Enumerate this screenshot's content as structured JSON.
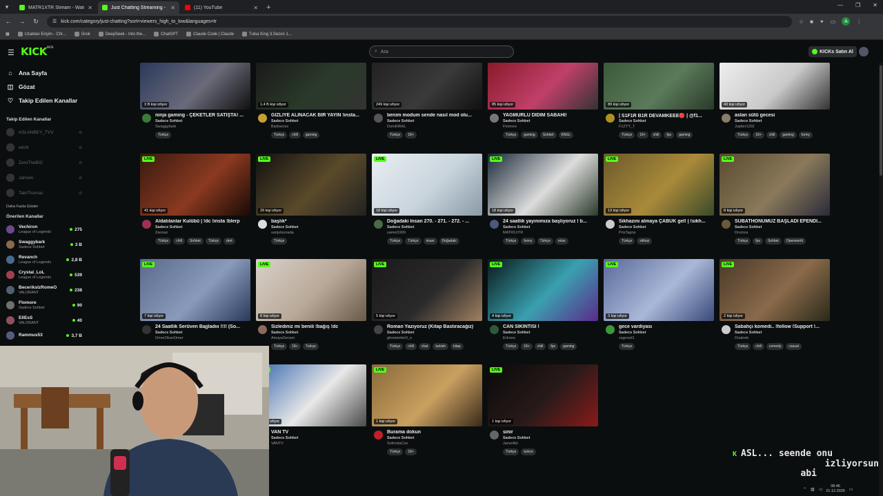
{
  "browser": {
    "tabs": [
      {
        "title": "MATR1XTR Stream - Watch Live",
        "color": "#53fc18",
        "active": false
      },
      {
        "title": "Just Chatting Streaming - Live",
        "color": "#53fc18",
        "active": true
      },
      {
        "title": "(11) YouTube",
        "color": "#ff0000",
        "active": false
      }
    ],
    "url": "kick.com/category/just-chatting?sort=viewers_high_to_low&languages=tr",
    "bookmarks": [
      "Uzaktan Erişim - Chr...",
      "Grok",
      "DeepSeek - Into the...",
      "ChatGPT",
      "Claude Code | Claude",
      "Tulsa King 3.Sezon 1..."
    ]
  },
  "header": {
    "logo": "KICK",
    "logo_sup": "BETA",
    "search_placeholder": "Ara",
    "kicks_button": "KICKs Satın Al"
  },
  "sidebar": {
    "nav": [
      {
        "label": "Ana Sayfa",
        "icon": "home-icon",
        "glyph": "⌂"
      },
      {
        "label": "Gözat",
        "icon": "compass-icon",
        "glyph": "◫"
      },
      {
        "label": "Takip Edilen Kanallar",
        "icon": "heart-icon",
        "glyph": "♡"
      }
    ],
    "followed_title": "Takip Edilen Kanallar",
    "followed": [
      {
        "name": "ASLANBEY_TVV"
      },
      {
        "name": "wtcN"
      },
      {
        "name": "ZeroTheBIC"
      },
      {
        "name": "Jahrein"
      },
      {
        "name": "TaleThomas"
      }
    ],
    "more_label": "Daha Fazla Göster",
    "recommended_title": "Önerilen Kanallar",
    "recommended": [
      {
        "name": "Vechiron",
        "category": "League of Legends",
        "viewers": "275",
        "color": "#6b4a8a"
      },
      {
        "name": "Swaggybark",
        "category": "Sadece Sohbet",
        "viewers": "3 B",
        "color": "#8a6a4a"
      },
      {
        "name": "Revanch",
        "category": "League of Legends",
        "viewers": "2,8 B",
        "color": "#4a6a8a"
      },
      {
        "name": "Crystal_LoL",
        "category": "League of Legends",
        "viewers": "539",
        "color": "#a04050"
      },
      {
        "name": "BecerikslzRomeO",
        "category": "VALORANT",
        "viewers": "238",
        "color": "#506070"
      },
      {
        "name": "Flomore",
        "category": "Sadece Sohbet",
        "viewers": "90",
        "color": "#707070"
      },
      {
        "name": "EllEsS",
        "category": "VALORANT",
        "viewers": "40",
        "color": "#905060"
      },
      {
        "name": "Rammus53",
        "category": "",
        "viewers": "3,7 B",
        "color": "#5a5a80"
      }
    ]
  },
  "cards": [
    {
      "row": 0,
      "col": 0,
      "live": false,
      "views": "3 B kişi izliyor",
      "title": "ninja gaming - ÇEKETLER SATIŞTA! ...",
      "category": "Sadece Sohbet",
      "channel": "Swaggybark",
      "tags": [
        "Türkçe"
      ],
      "avatar": "#3a7a3a",
      "thumb": [
        "#2a3a5a",
        "#6a6a7a",
        "#111"
      ]
    },
    {
      "row": 0,
      "col": 1,
      "live": false,
      "views": "1,4 B kişi izliyor",
      "title": "GİZLİYE ALINACAK BİR YAYIN !insta...",
      "category": "Sadece Sohbet",
      "channel": "Barbaross",
      "tags": [
        "Türkçe",
        "chill",
        "gaming"
      ],
      "avatar": "#c8a030",
      "thumb": [
        "#1a1a1a",
        "#2a3a2a",
        "#333"
      ]
    },
    {
      "row": 0,
      "col": 2,
      "live": false,
      "views": "249 kişi izliyor",
      "title": "benim modum sende nasıl mod olu...",
      "category": "Sadece Sohbet",
      "channel": "DomKIRAL",
      "tags": [
        "Türkçe",
        "18+"
      ],
      "avatar": "#555",
      "thumb": [
        "#222",
        "#3a3a3a",
        "#111"
      ]
    },
    {
      "row": 0,
      "col": 3,
      "live": false,
      "views": "85 kişi izliyor",
      "title": "YAĞMURLU DİDİM SABAHI!",
      "category": "Sadece Sohbet",
      "channel": "Flomore",
      "tags": [
        "Türkçe",
        "gaming",
        "Sohbet",
        "KNGL"
      ],
      "avatar": "#777",
      "thumb": [
        "#8a1a2a",
        "#c0406a",
        "#333"
      ]
    },
    {
      "row": 0,
      "col": 4,
      "live": false,
      "views": "89 kişi izliyor",
      "title": "| S1F1R B1R DEVAMKEEE🔴 | @f1...",
      "category": "Sadece Sohbet",
      "channel": "F1ZYY_T",
      "tags": [
        "Türkçe",
        "18+",
        "chill",
        "fps",
        "gaming"
      ],
      "avatar": "#b09020",
      "thumb": [
        "#3a5a3a",
        "#5a7a5a",
        "#2a3a2a"
      ]
    },
    {
      "row": 0,
      "col": 5,
      "live": false,
      "views": "43 kişi izliyor",
      "title": "aslan sütü gecesi",
      "category": "Sadece Sohbet",
      "channel": "Jupiter1202",
      "tags": [
        "Türkçe",
        "18+",
        "chill",
        "gaming",
        "funny"
      ],
      "avatar": "#8a7a6a",
      "thumb": [
        "#eee",
        "#c9c9c9",
        "#333"
      ]
    },
    {
      "row": 1,
      "col": 0,
      "live": true,
      "views": "41 kişi izliyor",
      "title": "Aldatılanlar Kulübü | !dc !insta !blerp",
      "category": "Sadece Sohbet",
      "channel": "Zaonaz",
      "tags": [
        "Türkçe",
        "chill",
        "Sohbet",
        "Türkçe",
        "dert"
      ],
      "avatar": "#a03050",
      "thumb": [
        "#3a1a10",
        "#8a3a20",
        "#1a0a05"
      ]
    },
    {
      "row": 1,
      "col": 1,
      "live": true,
      "views": "29 kişi izliyor",
      "title": "başlık*",
      "category": "Sadece Sohbet",
      "channel": "sanjutsunada",
      "tags": [
        "Türkçe"
      ],
      "avatar": "#ddd",
      "thumb": [
        "#111",
        "#5a4a2a",
        "#222"
      ]
    },
    {
      "row": 1,
      "col": 2,
      "live": true,
      "views": "18 kişi izliyor",
      "title": "Doğadaki İnsan 270. - 271. - 272. - ...",
      "category": "Sadece Sohbet",
      "channel": "samet1909",
      "tags": [
        "Türkçe",
        "Türkçe",
        "insan",
        "Doğadaki"
      ],
      "avatar": "#4a6a4a",
      "thumb": [
        "#e8eef2",
        "#c9d4dc",
        "#8a9aa8"
      ]
    },
    {
      "row": 1,
      "col": 3,
      "live": true,
      "views": "18 kişi izliyor",
      "title": "24 saatlik yayınımıza başlıyoruz ! b...",
      "category": "Sadece Sohbet",
      "channel": "MATR1XTR",
      "tags": [
        "Türkçe",
        "funny",
        "Türkçe",
        "relax"
      ],
      "avatar": "#4a5a7a",
      "thumb": [
        "#1a2a3a",
        "#dcdcdc",
        "#2a3a2a"
      ]
    },
    {
      "row": 1,
      "col": 4,
      "live": true,
      "views": "13 kişi izliyor",
      "title": "Sikhazını almaya ÇABUK gel! | !sikh...",
      "category": "Sadece Sohbet",
      "channel": "PrisTagna",
      "tags": [
        "Türkçe",
        "sikhaz"
      ],
      "avatar": "#ccc",
      "thumb": [
        "#6a5a2a",
        "#aa8a3a",
        "#3a4a2a"
      ]
    },
    {
      "row": 1,
      "col": 5,
      "live": true,
      "views": "8 kişi izliyor",
      "title": "SUBATHONUMUZ BAŞLADI EFENDİ...",
      "category": "Sadece Sohbet",
      "channel": "Drumza",
      "tags": [
        "Türkçe",
        "fps",
        "Sohbet",
        "Openworld"
      ],
      "avatar": "#6a5a3a",
      "thumb": [
        "#5a4a30",
        "#8a7a5a",
        "#2a2a3a"
      ]
    },
    {
      "row": 2,
      "col": 0,
      "live": true,
      "views": "7 kişi izliyor",
      "title": "24 Saatlik Serüven Bajjladııı !!!! (So...",
      "category": "Sadece Sohbet",
      "channel": "OmerOkanOmer",
      "tags": [],
      "avatar": "#333",
      "thumb": [
        "#5a6a8a",
        "#8a9aba",
        "#2a3a5a"
      ]
    },
    {
      "row": 2,
      "col": 1,
      "live": true,
      "views": "8 kişi izliyor",
      "title": "Sizlediniz mi benili !bağış !dc",
      "category": "Sadece Sohbet",
      "channel": "AmayaSensei",
      "tags": [
        "Türkçe",
        "18+",
        "Türkçe"
      ],
      "avatar": "#8a6a5a",
      "thumb": [
        "#d8d0c8",
        "#b8a898",
        "#6a5a4a"
      ]
    },
    {
      "row": 2,
      "col": 2,
      "live": true,
      "views": "5 kişi izliyor",
      "title": "Roman Yazıyoruz (Kitap Bastıracağız)",
      "category": "Sadece Sohbet",
      "channel": "ghostwriter0_o",
      "tags": [
        "Türkçe",
        "chill",
        "chat",
        "turkish",
        "kitap"
      ],
      "avatar": "#444",
      "thumb": [
        "#1a1a1a",
        "#2a2a2a",
        "#a08060"
      ]
    },
    {
      "row": 2,
      "col": 3,
      "live": true,
      "views": "4 kişi izliyor",
      "title": "CAN SIKINTISI !",
      "category": "Sadece Sohbet",
      "channel": "Ertrsea",
      "tags": [
        "Türkçe",
        "18+",
        "chill",
        "fps",
        "gaming"
      ],
      "avatar": "#2a5a3a",
      "thumb": [
        "#0a1a1a",
        "#3aa0b0",
        "#5a2a8a"
      ]
    },
    {
      "row": 2,
      "col": 4,
      "live": true,
      "views": "3 kişi izliyor",
      "title": "gece vardiyası",
      "category": "Sadece Sohbet",
      "channel": "zagrozd1",
      "tags": [
        "Türkçe"
      ],
      "avatar": "#3a9a3a",
      "thumb": [
        "#5a6a9a",
        "#aab8d8",
        "#3a4a7a"
      ]
    },
    {
      "row": 2,
      "col": 5,
      "live": true,
      "views": "2 kişi izliyor",
      "title": "Sabahçı komedi.. !follow !Support !...",
      "category": "Sadece Sohbet",
      "channel": "Doaloek",
      "tags": [
        "Türkçe",
        "chill",
        "comedy",
        "casual"
      ],
      "avatar": "#ccc",
      "thumb": [
        "#4a3a2a",
        "#8a6a4a",
        "#2a2a1a"
      ]
    },
    {
      "row": 3,
      "col": 1,
      "live": true,
      "views": "1 kişi izliyor",
      "title": "VAN TV",
      "category": "Sadece Sohbet",
      "channel": "VANTV",
      "tags": [],
      "avatar": "#333",
      "thumb": [
        "#3a6ab0",
        "#e8e8e8",
        "#4a4a4a"
      ]
    },
    {
      "row": 3,
      "col": 2,
      "live": true,
      "views": "1 kişi izliyor",
      "title": "Burama dokun",
      "category": "Sadece Sohbet",
      "channel": "SofondaCox",
      "tags": [
        "Türkçe",
        "18+"
      ],
      "avatar": "#c0202a",
      "thumb": [
        "#8a6a3a",
        "#c8a060",
        "#3a2a1a"
      ]
    },
    {
      "row": 3,
      "col": 3,
      "live": true,
      "views": "1 kişi izliyor",
      "title": "sinir",
      "category": "Sadece Sohbet",
      "channel": "JanerAbi",
      "tags": [
        "Türkçe",
        "turkce"
      ],
      "avatar": "#666",
      "thumb": [
        "#0a0a0a",
        "#2a1a1a",
        "#8a1a1a"
      ]
    }
  ],
  "overlay": {
    "k": "K",
    "line1": "ASL... seende onu",
    "line2": "izliyorsun",
    "line3": "abi"
  },
  "tray": {
    "time": "08:46",
    "date": "21.12.2025"
  }
}
